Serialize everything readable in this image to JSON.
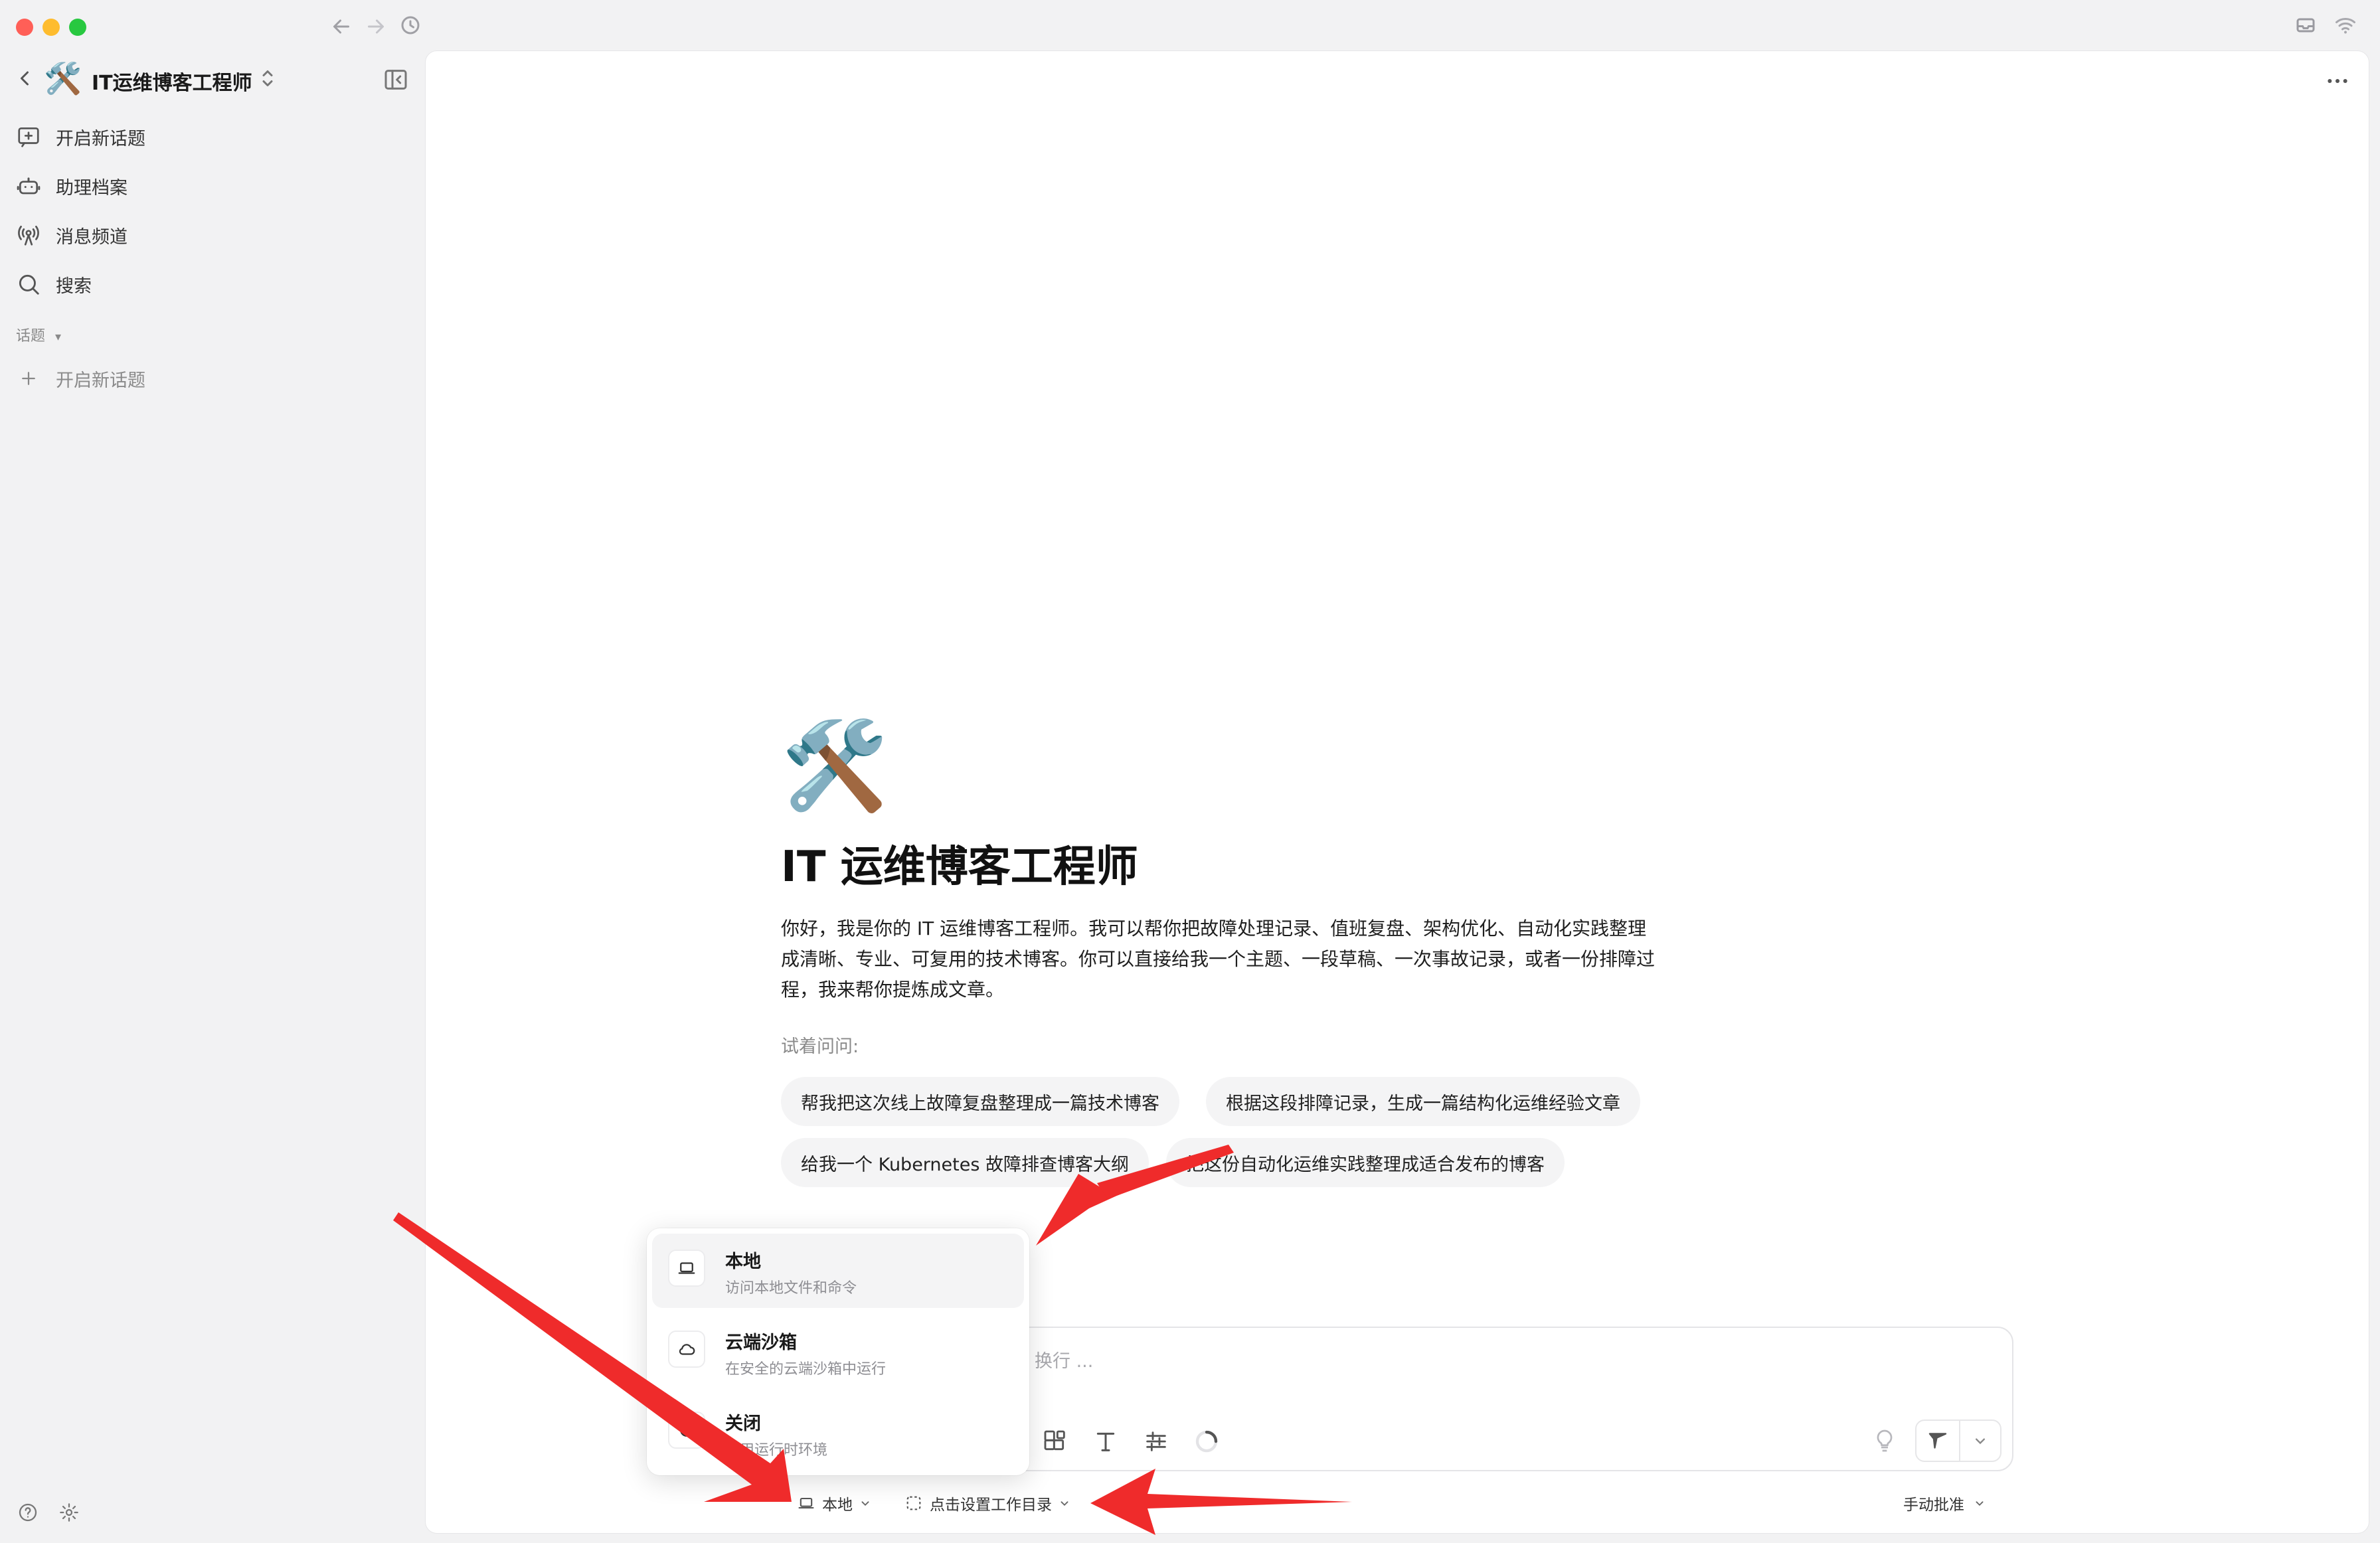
{
  "window": {
    "traffic_lights": {
      "close": "#ff5f57",
      "minimize": "#febc2e",
      "zoom": "#28c840"
    },
    "nav": {
      "back_icon": "arrow-left-icon",
      "forward_icon": "arrow-right-icon",
      "history_icon": "clock-icon"
    },
    "right_icons": [
      "inbox-icon",
      "wifi-icon"
    ]
  },
  "sidebar": {
    "agent_name": "IT运维博客工程师",
    "agent_emoji": "🛠️",
    "items": [
      {
        "label": "开启新话题",
        "icon": "new-chat-icon"
      },
      {
        "label": "助理档案",
        "icon": "bot-icon"
      },
      {
        "label": "消息频道",
        "icon": "broadcast-icon"
      },
      {
        "label": "搜索",
        "icon": "search-icon"
      }
    ],
    "section_label": "话题",
    "section_caret": "▾",
    "new_topic_label": "开启新话题",
    "bottom_icons": [
      "help-icon",
      "settings-icon"
    ]
  },
  "main": {
    "more_icon": "more-icon",
    "welcome": {
      "emoji": "🛠️",
      "title": "IT 运维博客工程师",
      "description": "你好，我是你的 IT 运维博客工程师。我可以帮你把故障处理记录、值班复盘、架构优化、自动化实践整理成清晰、专业、可复用的技术博客。你可以直接给我一个主题、一段草稿、一次事故记录，或者一份排障过程，我来帮你提炼成文章。",
      "try_label": "试着问问:",
      "suggestions": [
        "帮我把这次线上故障复盘整理成一篇技术博客",
        "根据这段排障记录，生成一篇结构化运维经验文章",
        "给我一个 Kubernetes 故障排查博客大纲",
        "把这份自动化运维实践整理成适合发布的博客"
      ]
    },
    "input": {
      "placeholder_visible": "换行 ..."
    },
    "footer": {
      "env_label": "本地",
      "workdir_label": "点击设置工作目录",
      "approval_label": "手动批准"
    }
  },
  "env_popup": {
    "options": [
      {
        "title": "本地",
        "subtitle": "访问本地文件和命令",
        "icon": "laptop-icon",
        "selected": true
      },
      {
        "title": "云端沙箱",
        "subtitle": "在安全的云端沙箱中运行",
        "icon": "cloud-icon",
        "selected": false
      },
      {
        "title": "关闭",
        "subtitle": "禁用运行时环境",
        "icon": "disabled-icon",
        "selected": false
      }
    ]
  },
  "annotations": {
    "arrow_color": "#ef2b2b"
  }
}
